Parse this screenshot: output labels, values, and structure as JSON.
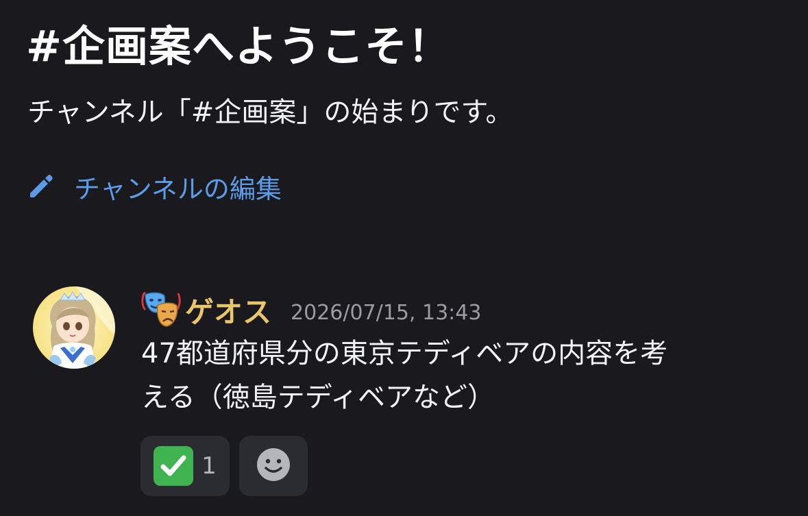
{
  "channel": {
    "welcome_title": "#企画案へようこそ！",
    "welcome_subtitle": "チャンネル「#企画案」の始まりです。",
    "edit_label": "チャンネルの編集",
    "edit_icon": "pencil-icon"
  },
  "message": {
    "role_icon": "performing-arts-icon",
    "username": "ゲオス",
    "timestamp": "2026/07/15, 13:43",
    "text_lines": [
      "47都道府県分の東京テディベアの内容を考",
      "える（徳島テディベアなど）"
    ],
    "reactions": [
      {
        "emoji": "white-check-mark",
        "count": "1"
      }
    ],
    "add_reaction_icon": "smiley-face-icon"
  },
  "colors": {
    "background": "#1a1a1e",
    "link": "#5b9be8",
    "username": "#e9c66b",
    "timestamp": "#9b9ca3",
    "reaction_bg": "#2b2c31",
    "check_green": "#3fb34f"
  }
}
